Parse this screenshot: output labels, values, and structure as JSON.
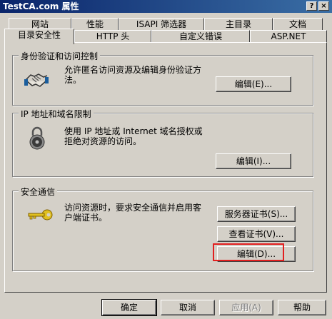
{
  "window": {
    "title": "TestCA.com 属性",
    "help_glyph": "?",
    "close_glyph": "×"
  },
  "tabs_row1": [
    "网站",
    "性能",
    "ISAPI 筛选器",
    "主目录",
    "文档"
  ],
  "tabs_row2": [
    "目录安全性",
    "HTTP 头",
    "自定义错误",
    "ASP.NET"
  ],
  "groups": {
    "auth": {
      "title": "身份验证和访问控制",
      "desc_line1": "允许匿名访问资源及编辑身份验证方",
      "desc_line2": "法。",
      "edit_button": "编辑(E)..."
    },
    "ip": {
      "title": "IP 地址和域名限制",
      "desc_line1": "使用 IP 地址或 Internet 域名授权或",
      "desc_line2": "拒绝对资源的访问。",
      "edit_button": "编辑(I)..."
    },
    "secure": {
      "title": "安全通信",
      "desc_line1": "访问资源时，要求安全通信并启用客",
      "desc_line2": "户端证书。",
      "server_cert_button": "服务器证书(S)...",
      "view_cert_button": "查看证书(V)...",
      "edit_button": "编辑(D)..."
    }
  },
  "footer": {
    "ok": "确定",
    "cancel": "取消",
    "apply": "应用(A)",
    "help": "帮助"
  },
  "colors": {
    "face": "#d4d0c8",
    "title_start": "#0a246a",
    "title_end": "#3a6ea5",
    "highlight": "#e21f1f"
  }
}
